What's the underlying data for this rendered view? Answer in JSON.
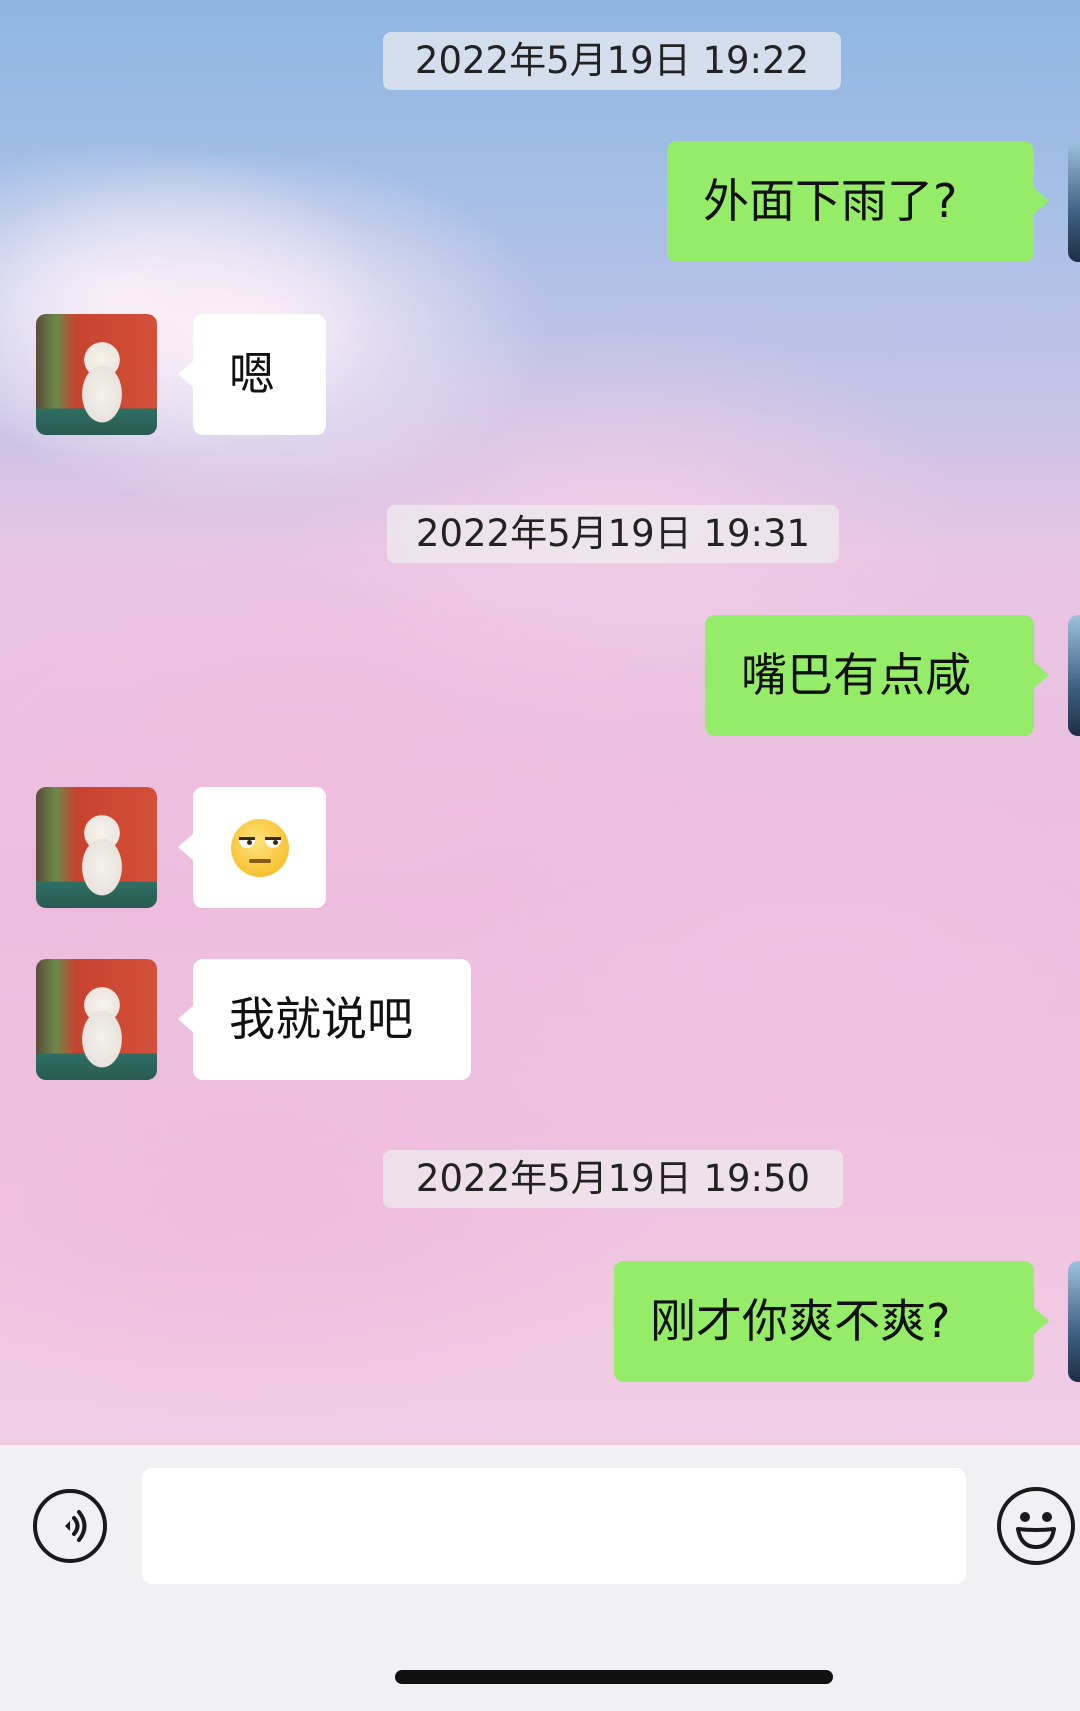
{
  "messages": [
    {
      "type": "timestamp",
      "text": "2022年5月19日 19:22"
    },
    {
      "type": "sent",
      "text": "外面下雨了?"
    },
    {
      "type": "received",
      "text": "嗯"
    },
    {
      "type": "timestamp",
      "text": "2022年5月19日 19:31"
    },
    {
      "type": "sent",
      "text": "嘴巴有点咸"
    },
    {
      "type": "received",
      "emoji": "unamused-face"
    },
    {
      "type": "received",
      "text": "我就说吧"
    },
    {
      "type": "timestamp",
      "text": "2022年5月19日 19:50"
    },
    {
      "type": "sent",
      "text": "刚才你爽不爽?"
    }
  ],
  "input_bar": {
    "voice_icon": "voice-icon",
    "message_value": "",
    "emoji_icon": "smiley-icon"
  },
  "colors": {
    "sent_bubble": "#95ec69",
    "received_bubble": "#ffffff",
    "input_bar_bg": "#f1f1f3"
  }
}
